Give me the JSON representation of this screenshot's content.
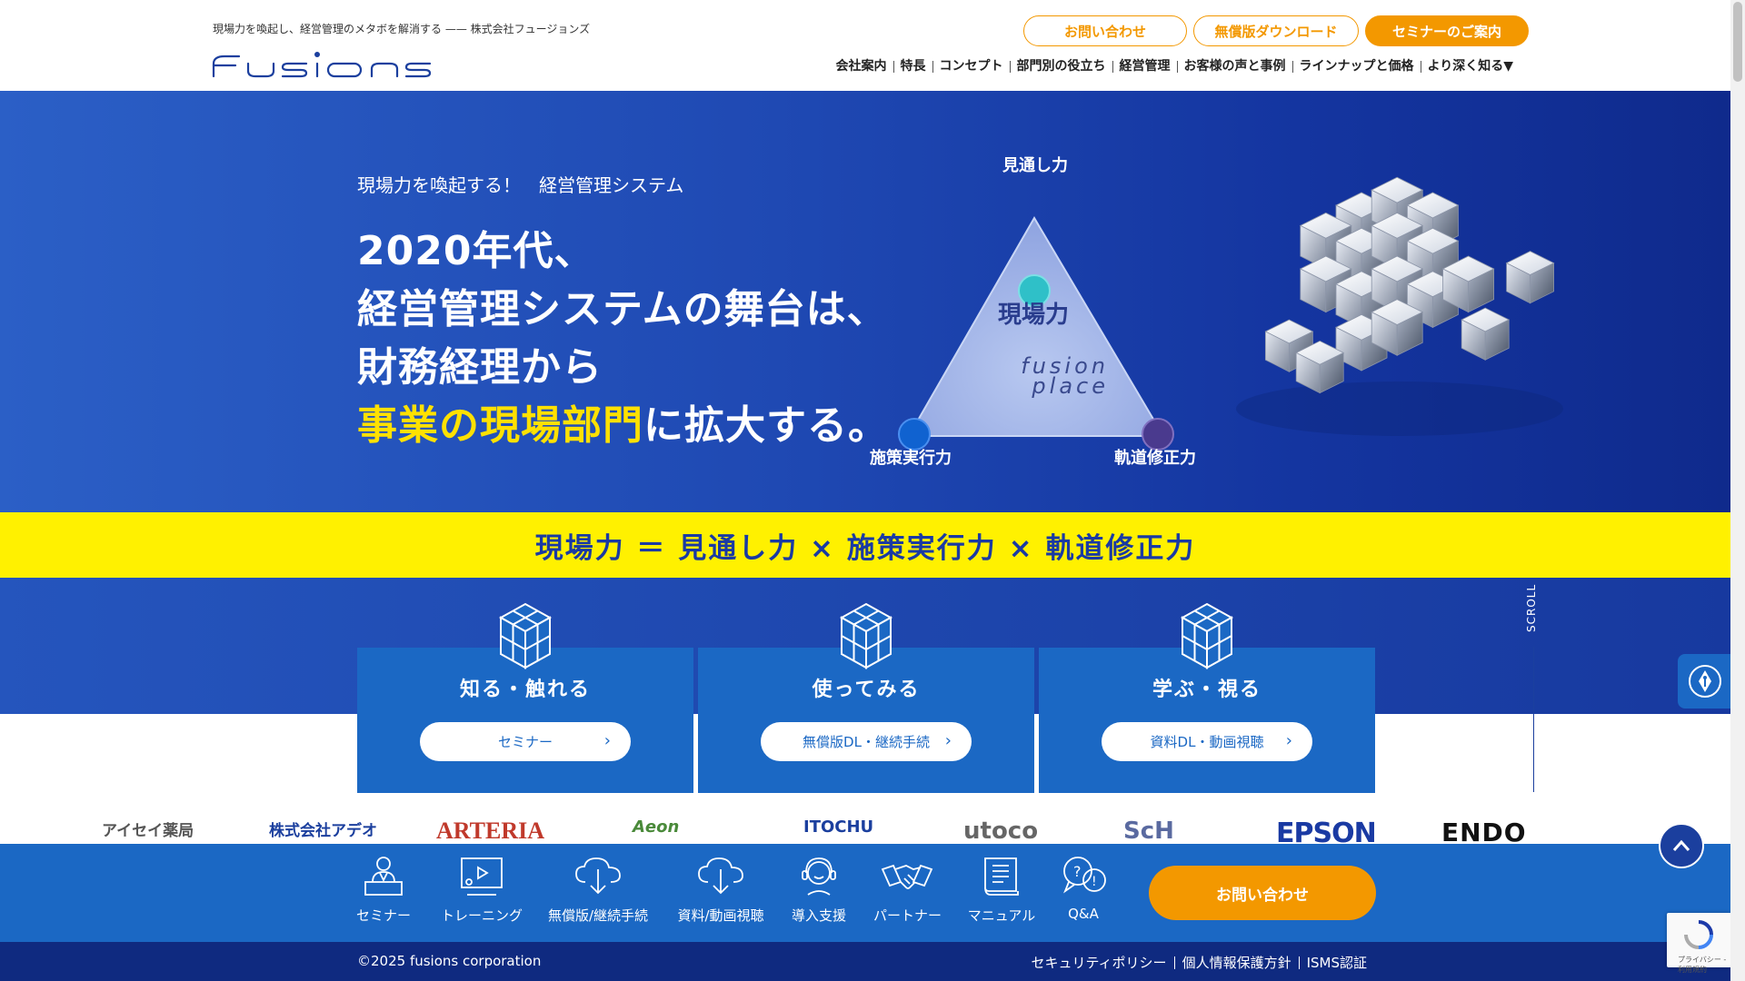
{
  "header": {
    "tagline": "現場力を喚起し、経営管理のメタボを解消する —— 株式会社フュージョンズ",
    "logo_text": "fusions",
    "buttons": {
      "contact": "お問い合わせ",
      "download": "無償版ダウンロード",
      "seminar": "セミナーのご案内"
    },
    "nav": [
      "会社案内",
      "特長",
      "コンセプト",
      "部門別の役立ち",
      "経営管理",
      "お客様の声と事例",
      "ラインナップと価格",
      "より深く知る▼"
    ]
  },
  "hero": {
    "subtitle": "現場力を喚起する！　経営管理システム",
    "line1": "2020年代、",
    "line2": "経営管理システムの舞台は、",
    "line3": "財務経理から",
    "line4_highlight": "事業の現場部門",
    "line4_rest": "に拡大する。",
    "triangle": {
      "top": "見通し力",
      "left": "施策実行力",
      "right": "軌道修正力",
      "center": "現場力",
      "brand_line1": "fusion",
      "brand_line2": "place"
    }
  },
  "band": {
    "formula": "現場力 ＝ 見通し力 × 施策実行力 × 軌道修正力"
  },
  "cards": [
    {
      "title": "知る・触れる",
      "button": "セミナー"
    },
    {
      "title": "使ってみる",
      "button": "無償版DL・継続手続"
    },
    {
      "title": "学ぶ・視る",
      "button": "資料DL・動画視聴"
    }
  ],
  "scroll_label": "SCROLL",
  "clients": [
    "アイセイ薬局",
    "株式会社アデオ",
    "ARTERIA",
    "Aeon",
    "ITOCHU",
    "utoco",
    "ScH",
    "EPSON",
    "ENDO"
  ],
  "bottom_nav": [
    {
      "label": "セミナー",
      "icon": "seminar-icon"
    },
    {
      "label": "トレーニング",
      "icon": "training-icon"
    },
    {
      "label": "無償版/継続手続",
      "icon": "cloud-download-icon"
    },
    {
      "label": "資料/動画視聴",
      "icon": "cloud-download-icon"
    },
    {
      "label": "導入支援",
      "icon": "support-person-icon"
    },
    {
      "label": "パートナー",
      "icon": "handshake-icon"
    },
    {
      "label": "マニュアル",
      "icon": "manual-book-icon"
    },
    {
      "label": "Q&A",
      "icon": "question-bubble-icon"
    }
  ],
  "bottom_contact": "お問い合わせ",
  "footer": {
    "copyright": "©2025 fusions corporation",
    "links": [
      "セキュリティポリシー",
      "個人情報保護方針",
      "ISMS認証"
    ]
  },
  "recaptcha_text": "プライバシー - 利用規約",
  "colors": {
    "accent_orange": "#f39800",
    "brand_blue": "#1b68c4",
    "highlight_yellow": "#ffe100",
    "band_yellow": "#fff100"
  }
}
